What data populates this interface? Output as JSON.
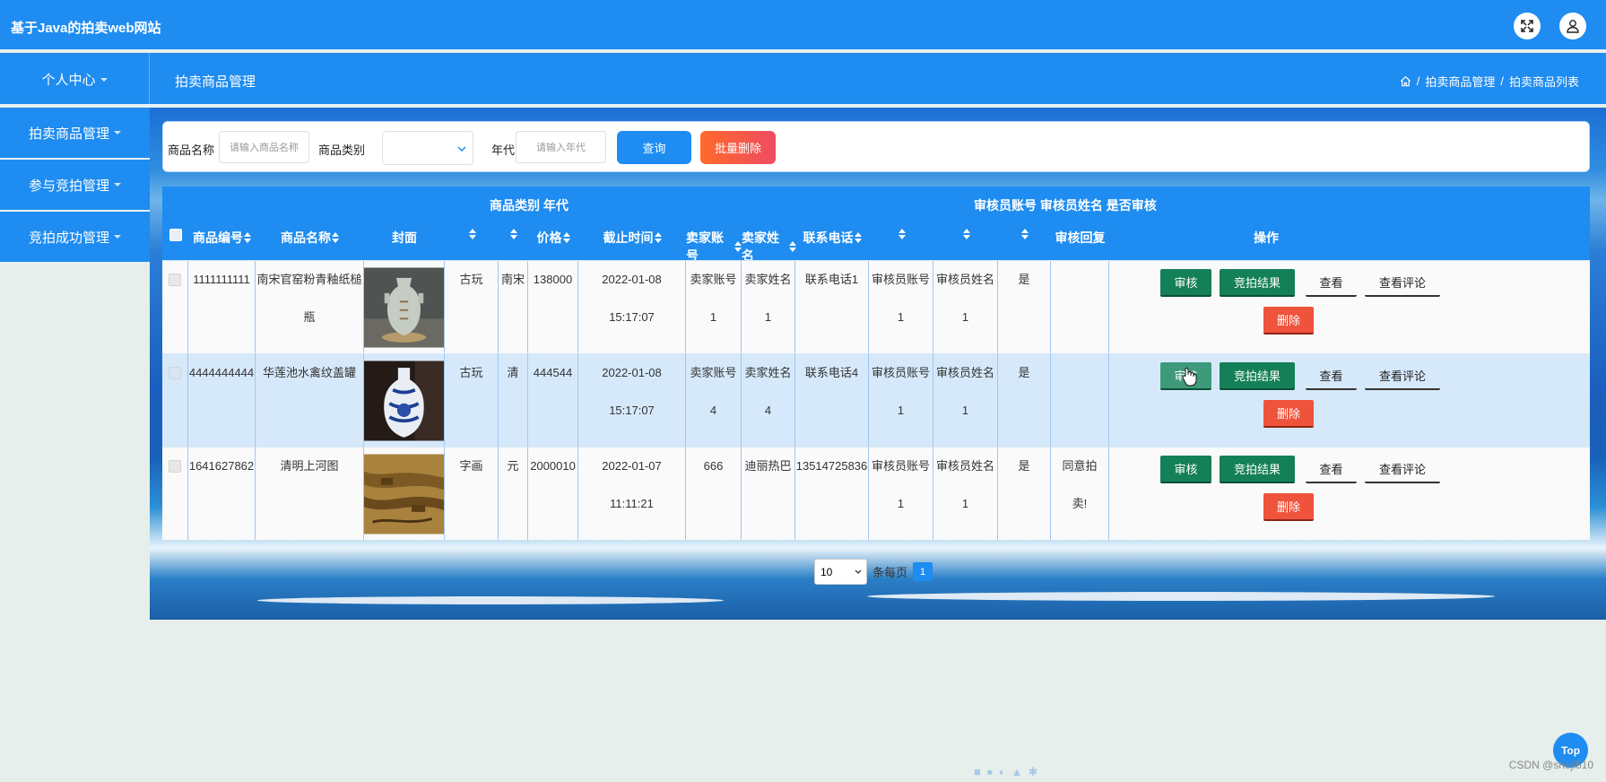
{
  "app": {
    "title": "基于Java的拍卖web网站"
  },
  "topbar": {
    "fullscreen_icon": "expand-icon",
    "user_icon": "user-icon"
  },
  "subbar": {
    "personal_center": "个人中心",
    "section_title": "拍卖商品管理",
    "breadcrumb": [
      "拍卖商品管理",
      "拍卖商品列表"
    ],
    "breadcrumb_sep": "/"
  },
  "sidebar": {
    "items": [
      {
        "label": "拍卖商品管理"
      },
      {
        "label": "参与竞拍管理"
      },
      {
        "label": "竞拍成功管理"
      }
    ]
  },
  "search": {
    "name_label": "商品名称",
    "name_placeholder": "请输入商品名称",
    "category_label": "商品类别",
    "category_value": "",
    "year_label": "年代",
    "year_placeholder": "请输入年代",
    "query_btn": "查询",
    "batch_delete_btn": "批量删除"
  },
  "table": {
    "group_headers": {
      "category_year": "商品类别  年代",
      "auditor": "审核员账号  审核员姓名  是否审核"
    },
    "headers": {
      "id": "商品编号",
      "name": "商品名称",
      "cover": "封面",
      "price": "价格",
      "deadline": "截止时间",
      "seller_account": "卖家账号",
      "seller_name": "卖家姓名",
      "phone": "联系电话",
      "audit_reply": "审核回复",
      "actions": "操作"
    },
    "rows": [
      {
        "id": "1111111111",
        "name_l1": "南宋官窑粉青釉纸槌",
        "name_l2": "瓶",
        "category": "古玩",
        "year": "南宋",
        "price": "138000",
        "date": "2022-01-08",
        "time": "15:17:07",
        "seller_account_l1": "卖家账号",
        "seller_account_l2": "1",
        "seller_name_l1": "卖家姓名",
        "seller_name_l2": "1",
        "phone": "联系电话1",
        "auditor_account_l1": "审核员账号",
        "auditor_account_l2": "1",
        "auditor_name_l1": "审核员姓名",
        "auditor_name_l2": "1",
        "audited": "是",
        "reply_l1": "",
        "reply_l2": ""
      },
      {
        "id": "4444444444",
        "name_l1": "华莲池水禽纹盖罐",
        "name_l2": "",
        "category": "古玩",
        "year": "清",
        "price": "444544",
        "date": "2022-01-08",
        "time": "15:17:07",
        "seller_account_l1": "卖家账号",
        "seller_account_l2": "4",
        "seller_name_l1": "卖家姓名",
        "seller_name_l2": "4",
        "phone": "联系电话4",
        "auditor_account_l1": "审核员账号",
        "auditor_account_l2": "1",
        "auditor_name_l1": "审核员姓名",
        "auditor_name_l2": "1",
        "audited": "是",
        "reply_l1": "",
        "reply_l2": ""
      },
      {
        "id": "1641627862",
        "name_l1": "清明上河图",
        "name_l2": "",
        "category": "字画",
        "year": "元",
        "price": "2000010",
        "date": "2022-01-07",
        "time": "11:11:21",
        "seller_account_l1": "666",
        "seller_account_l2": "",
        "seller_name_l1": "迪丽热巴",
        "seller_name_l2": "",
        "phone": "13514725836",
        "auditor_account_l1": "审核员账号",
        "auditor_account_l2": "1",
        "auditor_name_l1": "审核员姓名",
        "auditor_name_l2": "1",
        "audited": "是",
        "reply_l1": "同意拍",
        "reply_l2": "卖!"
      }
    ],
    "actions": {
      "audit": "审核",
      "bid_result": "竞拍结果",
      "view": "查看",
      "view_comments": "查看评论",
      "delete": "删除"
    }
  },
  "pager": {
    "page_size": "10",
    "per_page_text": "条每页",
    "current_page": "1"
  },
  "to_top": "Top",
  "watermark": "CSDN @sheji510",
  "colors": {
    "primary": "#1e8cf0",
    "green": "#148057",
    "red": "#f0533c"
  }
}
